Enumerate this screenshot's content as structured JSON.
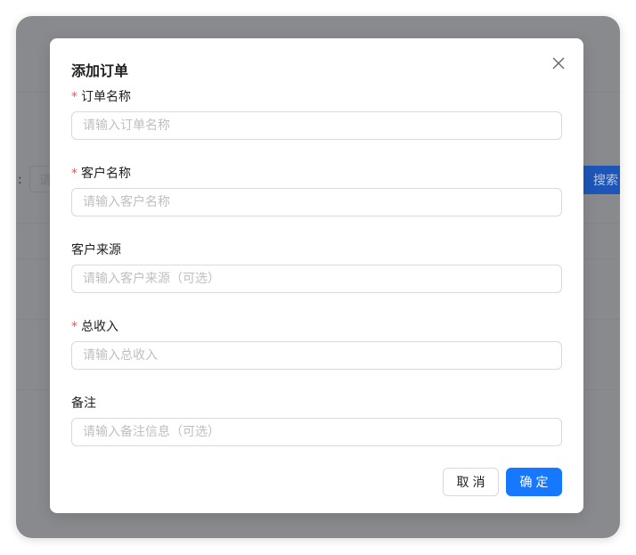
{
  "background": {
    "field_label_suffix": ":",
    "input_placeholder_fragment": "请",
    "search_button": "搜索"
  },
  "modal": {
    "title": "添加订单",
    "close_icon": "close-icon",
    "fields": [
      {
        "label": "订单名称",
        "required": true,
        "placeholder": "请输入订单名称",
        "value": ""
      },
      {
        "label": "客户名称",
        "required": true,
        "placeholder": "请输入客户名称",
        "value": ""
      },
      {
        "label": "客户来源",
        "required": false,
        "placeholder": "请输入客户来源（可选）",
        "value": ""
      },
      {
        "label": "总收入",
        "required": true,
        "placeholder": "请输入总收入",
        "value": ""
      },
      {
        "label": "备注",
        "required": false,
        "placeholder": "请输入备注信息（可选）",
        "value": ""
      }
    ],
    "required_mark": "*",
    "cancel_label": "取消",
    "ok_label": "确定"
  },
  "colors": {
    "primary": "#1677ff",
    "required": "#ff4d4f",
    "overlay": "#898a8d"
  }
}
